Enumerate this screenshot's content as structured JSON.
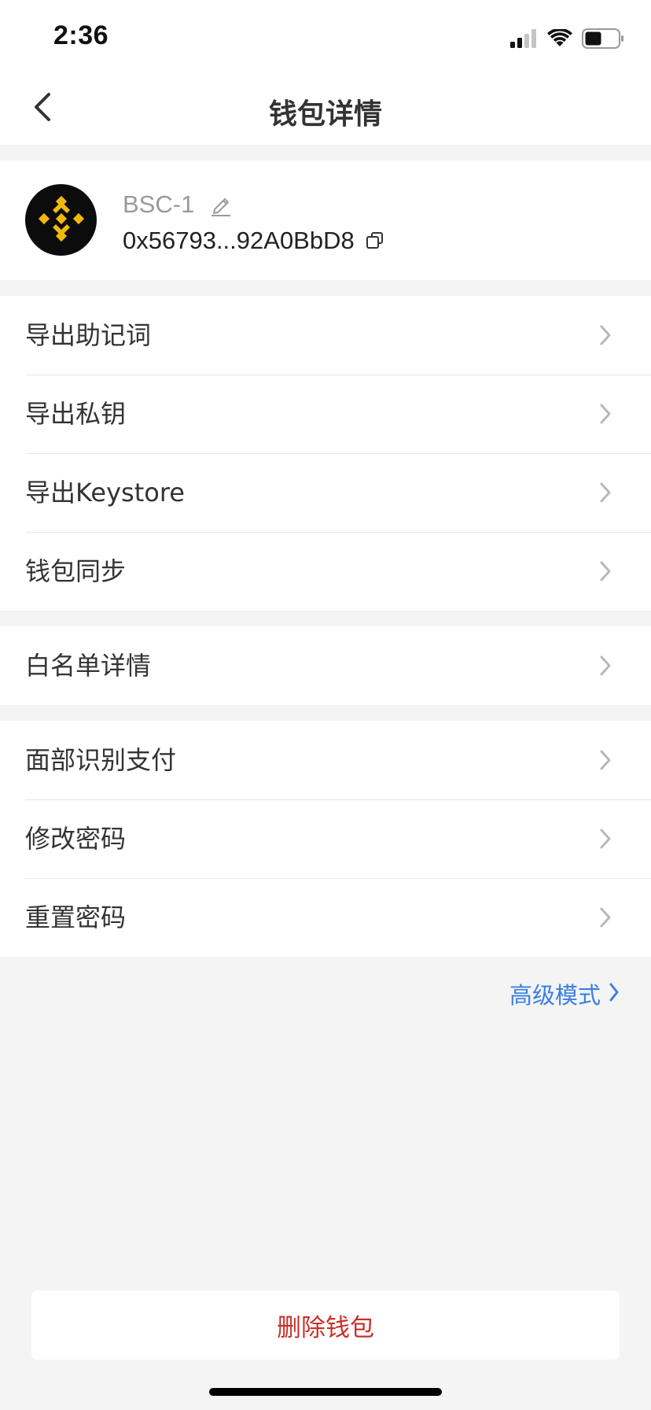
{
  "status_bar": {
    "time": "2:36"
  },
  "nav": {
    "title": "钱包详情"
  },
  "wallet": {
    "name": "BSC-1",
    "address": "0x56793...92A0BbD8"
  },
  "groups": [
    {
      "items": [
        {
          "label": "导出助记词"
        },
        {
          "label": "导出私钥"
        },
        {
          "label": "导出Keystore"
        },
        {
          "label": "钱包同步"
        }
      ]
    },
    {
      "items": [
        {
          "label": "白名单详情"
        }
      ]
    },
    {
      "items": [
        {
          "label": "面部识别支付"
        },
        {
          "label": "修改密码"
        },
        {
          "label": "重置密码"
        }
      ]
    }
  ],
  "advanced": {
    "label": "高级模式"
  },
  "delete": {
    "label": "删除钱包"
  },
  "colors": {
    "link_blue": "#3b7fe4",
    "danger_red": "#c8302a",
    "brand_gold": "#f0b90b",
    "background": "#f4f4f4"
  }
}
